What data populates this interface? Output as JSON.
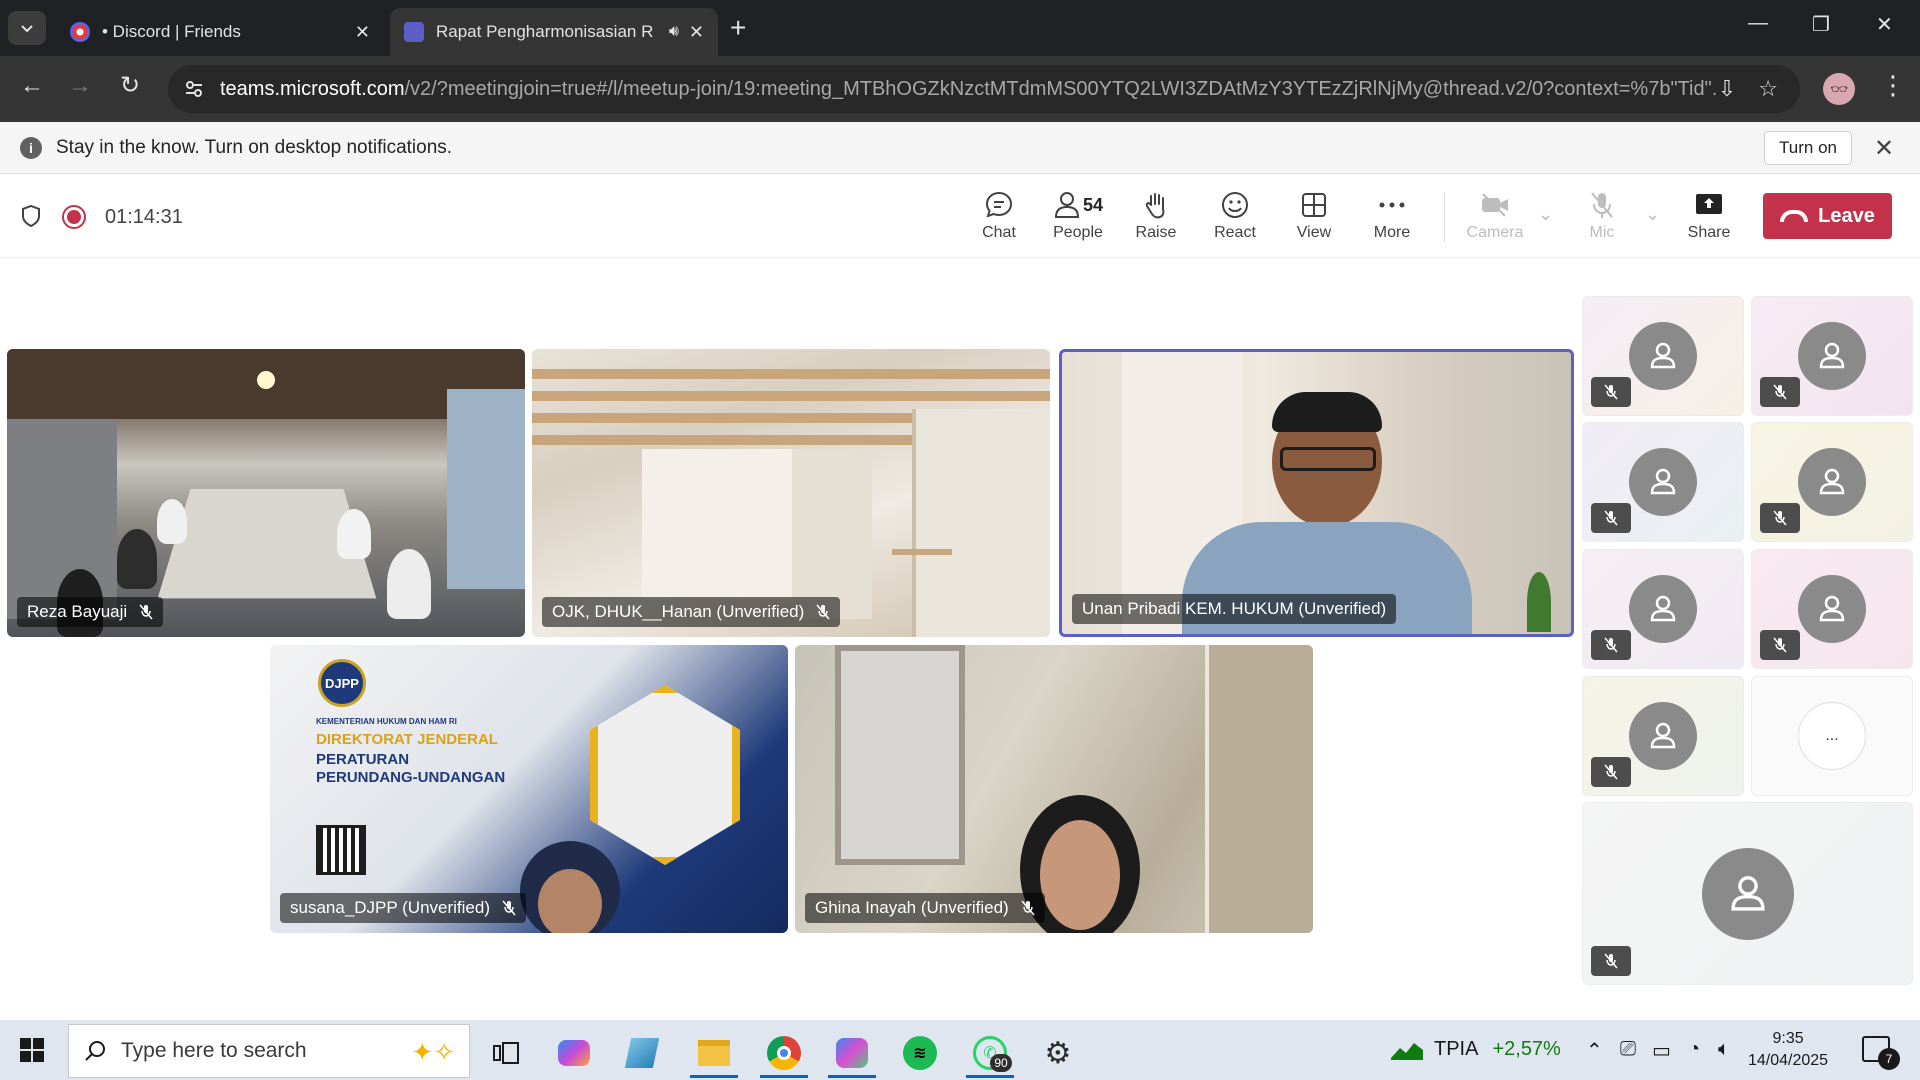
{
  "browser": {
    "tabs": [
      {
        "title": "• Discord | Friends",
        "favicon_color": "#5865f2"
      },
      {
        "title": "Rapat Pengharmonisasian R",
        "favicon_color": "#5b5fc7"
      }
    ],
    "url_host": "teams.microsoft.com",
    "url_path": "/v2/?meetingjoin=true#/l/meetup-join/19:meeting_MTBhOGZkNzctMTdmMS00YTQ2LWI3ZDAtMzY3YTEzZjRlNjMy@thread.v2/0?context=%7b\"Tid\"...",
    "profile_icon": "profile-avatar"
  },
  "notification": {
    "message": "Stay in the know. Turn on desktop notifications.",
    "button": "Turn on"
  },
  "meeting": {
    "timer": "01:14:31",
    "controls": {
      "chat": "Chat",
      "people": "People",
      "people_count": "54",
      "raise": "Raise",
      "react": "React",
      "view": "View",
      "more": "More",
      "camera": "Camera",
      "mic": "Mic",
      "share": "Share",
      "leave": "Leave"
    },
    "colors": {
      "leave": "#c4314b",
      "active_speaker": "#5b5fc7",
      "recording": "#c4314b"
    },
    "participants": [
      {
        "name": "Reza Bayuaji",
        "muted": true
      },
      {
        "name": "OJK, DHUK__Hanan (Unverified)",
        "muted": true
      },
      {
        "name": "Unan Pribadi KEM. HUKUM (Unverified)",
        "muted": false,
        "speaking": true
      },
      {
        "name": "susana_DJPP (Unverified)",
        "muted": true
      },
      {
        "name": "Ghina Inayah (Unverified)",
        "muted": true
      }
    ],
    "gallery_more_label": "...",
    "slide_text": {
      "logo": "DJPP",
      "ministry": "KEMENTERIAN HUKUM DAN HAM RI",
      "line1": "DIREKTORAT JENDERAL",
      "line2": "PERATURAN",
      "line3": "PERUNDANG-UNDANGAN"
    }
  },
  "taskbar": {
    "search_placeholder": "Type here to search",
    "whatsapp_badge": "90",
    "stock_name": "TPIA",
    "stock_change": "+2,57%",
    "time": "9:35",
    "date": "14/04/2025",
    "notification_count": "7"
  }
}
